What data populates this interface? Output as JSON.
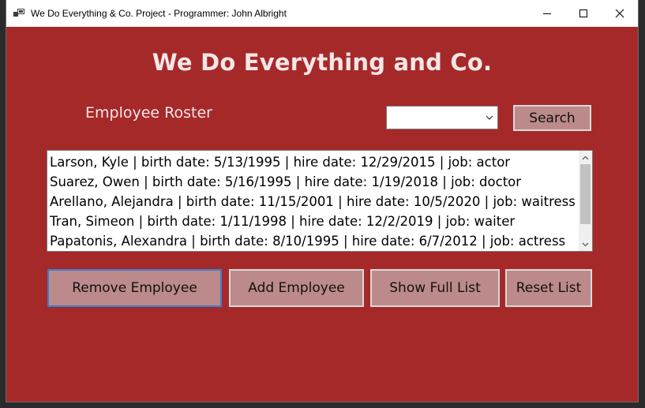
{
  "window": {
    "title": "We Do Everything & Co. Project - Programmer: John Albright",
    "icons": {
      "app": "app-window-icon",
      "minimize": "minimize-icon",
      "maximize": "maximize-icon",
      "close": "close-icon"
    }
  },
  "colors": {
    "background": "#a6292a",
    "heading_text": "#f4e6e6",
    "button_bg": "#bc8a8a",
    "focused_border": "#3a7fd1"
  },
  "header": {
    "title": "We Do Everything and Co."
  },
  "roster": {
    "label": "Employee Roster",
    "filter_select_value": "",
    "search_button": "Search"
  },
  "employees": [
    "Larson, Kyle | birth date: 5/13/1995 | hire date: 12/29/2015 | job: actor",
    "Suarez, Owen | birth date: 5/16/1995 | hire date: 1/19/2018 | job: doctor",
    "Arellano, Alejandra | birth date: 11/15/2001 | hire date: 10/5/2020 | job: waitress",
    "Tran, Simeon | birth date: 1/11/1998 | hire date: 12/2/2019 | job: waiter",
    "Papatonis, Alexandra | birth date: 8/10/1995 | hire date: 6/7/2012 | job: actress"
  ],
  "actions": {
    "remove": "Remove Employee",
    "add": "Add Employee",
    "show_full": "Show Full List",
    "reset": "Reset List"
  }
}
